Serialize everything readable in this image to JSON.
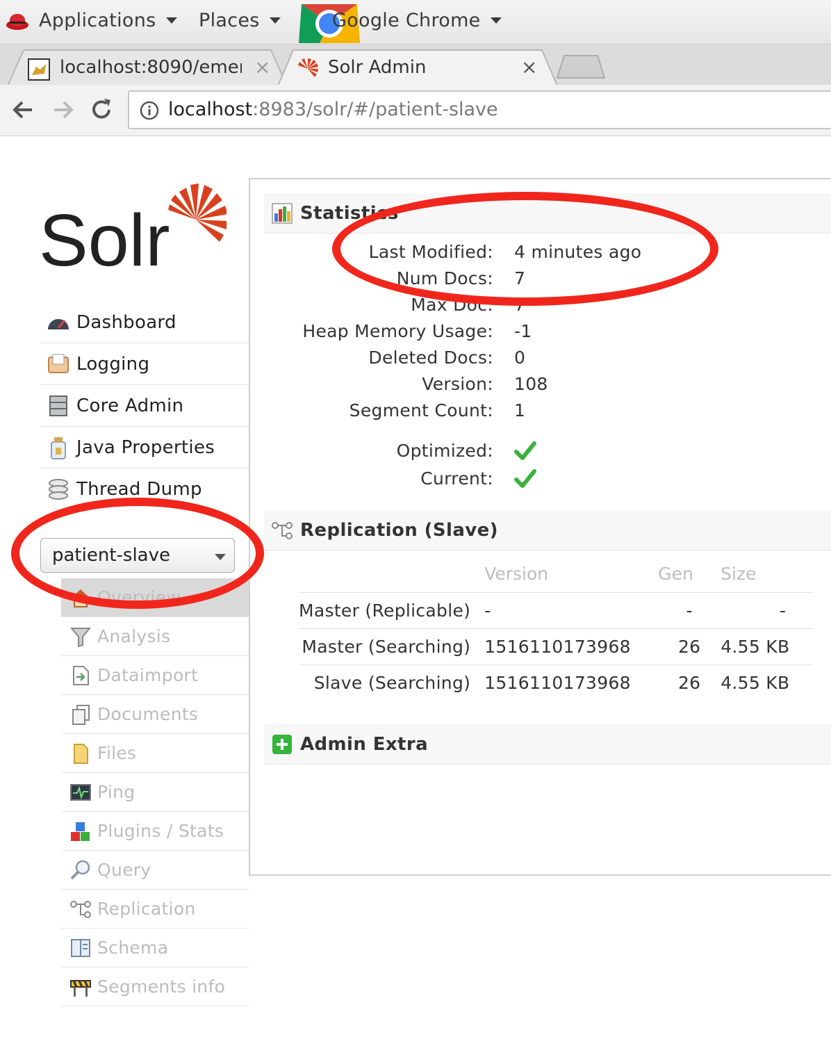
{
  "system_bar": {
    "applications_label": "Applications",
    "places_label": "Places",
    "browser_label": "Google Chrome"
  },
  "tabs": [
    {
      "title": "localhost:8090/emer",
      "close": "×",
      "icon": "tomcat-icon"
    },
    {
      "title": "Solr Admin",
      "close": "×",
      "icon": "solr-icon"
    }
  ],
  "address_bar": {
    "host": "localhost",
    "path": ":8983/solr/#/patient-slave"
  },
  "sidebar": {
    "logo_text": "Solr",
    "items": [
      {
        "label": "Dashboard",
        "icon": "dashboard-icon"
      },
      {
        "label": "Logging",
        "icon": "logging-icon"
      },
      {
        "label": "Core Admin",
        "icon": "core-admin-icon"
      },
      {
        "label": "Java Properties",
        "icon": "java-properties-icon"
      },
      {
        "label": "Thread Dump",
        "icon": "thread-dump-icon"
      }
    ],
    "core_selector": {
      "selected": "patient-slave"
    },
    "core_items": [
      {
        "label": "Overview",
        "icon": "home-icon",
        "active": true
      },
      {
        "label": "Analysis",
        "icon": "funnel-icon"
      },
      {
        "label": "Dataimport",
        "icon": "dataimport-icon"
      },
      {
        "label": "Documents",
        "icon": "documents-icon"
      },
      {
        "label": "Files",
        "icon": "files-icon"
      },
      {
        "label": "Ping",
        "icon": "ping-icon"
      },
      {
        "label": "Plugins / Stats",
        "icon": "plugins-icon"
      },
      {
        "label": "Query",
        "icon": "query-icon"
      },
      {
        "label": "Replication",
        "icon": "replication-icon"
      },
      {
        "label": "Schema",
        "icon": "schema-icon"
      },
      {
        "label": "Segments info",
        "icon": "segments-icon"
      }
    ]
  },
  "statistics": {
    "heading": "Statistics",
    "rows": [
      {
        "key": "Last Modified:",
        "value": "4 minutes ago"
      },
      {
        "key": "Num Docs:",
        "value": "7"
      },
      {
        "key": "Max Doc:",
        "value": "7"
      },
      {
        "key": "Heap Memory Usage:",
        "value": "-1"
      },
      {
        "key": "Deleted Docs:",
        "value": "0"
      },
      {
        "key": "Version:",
        "value": "108"
      },
      {
        "key": "Segment Count:",
        "value": "1"
      }
    ],
    "flags": [
      {
        "key": "Optimized:",
        "value": true
      },
      {
        "key": "Current:",
        "value": true
      }
    ]
  },
  "replication": {
    "heading": "Replication (Slave)",
    "columns": [
      "",
      "Version",
      "Gen",
      "Size"
    ],
    "rows": [
      [
        "Master (Replicable)",
        "-",
        "-",
        "-"
      ],
      [
        "Master (Searching)",
        "1516110173968",
        "26",
        "4.55 KB"
      ],
      [
        "Slave (Searching)",
        "1516110173968",
        "26",
        "4.55 KB"
      ]
    ]
  },
  "admin_extra": {
    "heading": "Admin Extra"
  },
  "colors": {
    "annotation_red": "#f0261c",
    "solr_red": "#d9411e",
    "check_green": "#3bb13b"
  }
}
